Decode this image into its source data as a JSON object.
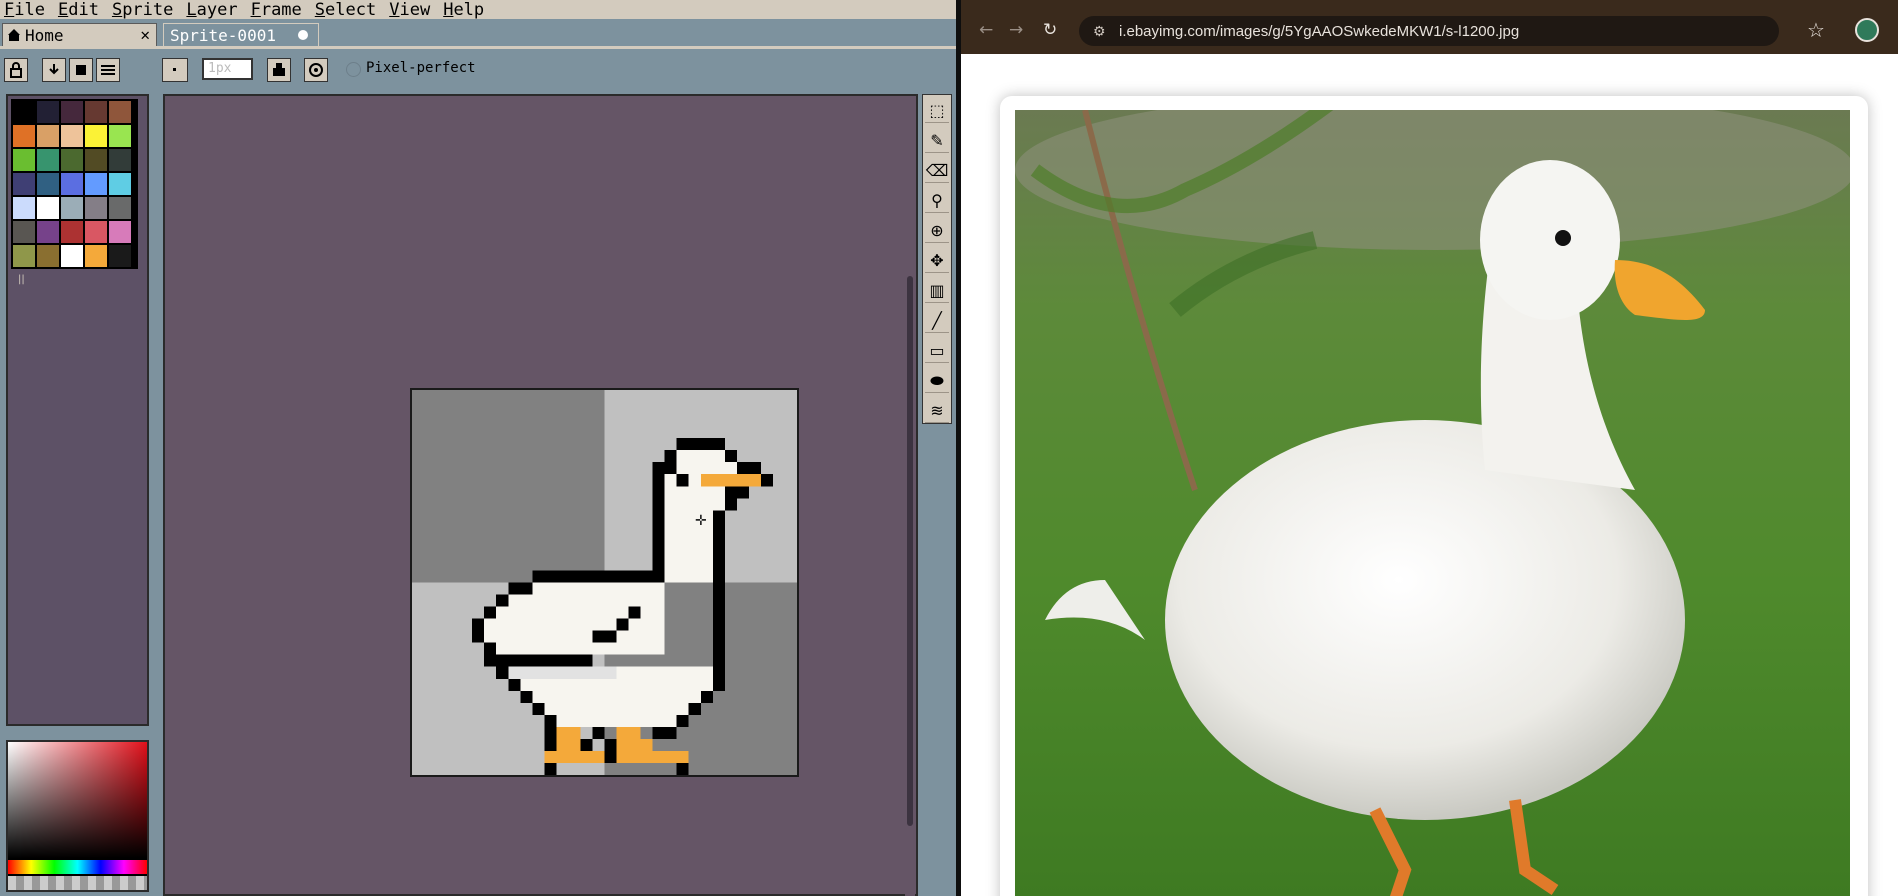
{
  "aseprite": {
    "menu": [
      "File",
      "Edit",
      "Sprite",
      "Layer",
      "Frame",
      "Select",
      "View",
      "Help"
    ],
    "tabs": [
      {
        "label": "Home",
        "close": "✕"
      },
      {
        "label": "Sprite-0001"
      }
    ],
    "context": {
      "brush_size_placeholder": "1px",
      "pixel_perfect_label": "Pixel-perfect"
    },
    "palette": [
      "#000000",
      "#222034",
      "#45283c",
      "#663931",
      "#8f563b",
      "#df7126",
      "#d9a066",
      "#eec39a",
      "#fbf236",
      "#99e550",
      "#6abe30",
      "#37946e",
      "#4b692f",
      "#524b24",
      "#323c39",
      "#3f3f74",
      "#306082",
      "#5b6ee1",
      "#639bff",
      "#5fcde4",
      "#cbdbfc",
      "#ffffff",
      "#9badb7",
      "#847e87",
      "#696a6a",
      "#595652",
      "#76428a",
      "#ac3232",
      "#d95763",
      "#d77bba",
      "#8f974a",
      "#8a6f30",
      "#ffffff",
      "#f4a93a",
      "#1a1a1a"
    ],
    "sprite_colors": {
      "bg_dark": "#818181",
      "bg_light": "#c0c0c0",
      "outline": "#000000",
      "body": "#f7f5ef",
      "shade": "#e2e2e2",
      "beak": "#f4a93a"
    },
    "tools": [
      "marquee-icon",
      "pencil-icon",
      "eraser-icon",
      "eyedropper-icon",
      "zoom-icon",
      "move-icon",
      "gradient-icon",
      "line-icon",
      "rectangle-icon",
      "ellipse-icon",
      "blur-icon"
    ]
  },
  "browser": {
    "url": "i.ebayimg.com/images/g/5YgAAOSwkedeMKW1/s-l1200.jpg"
  }
}
